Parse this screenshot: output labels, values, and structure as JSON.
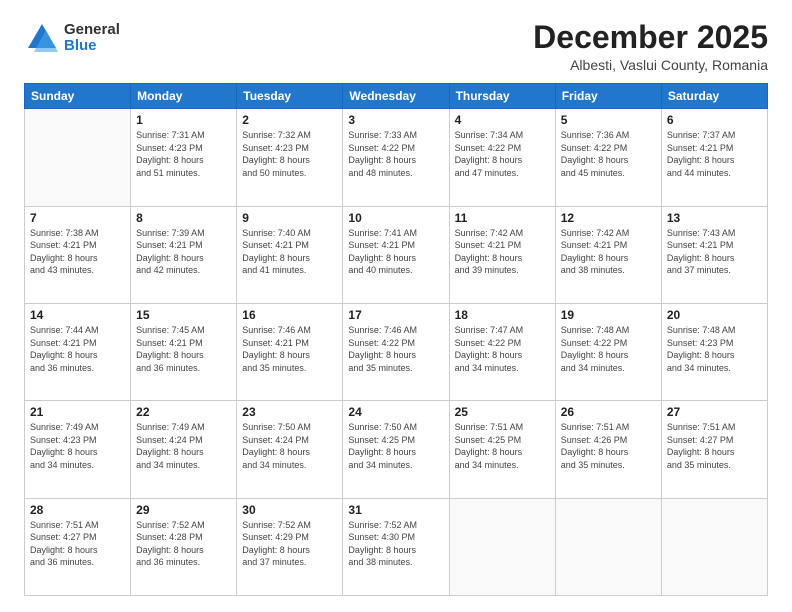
{
  "logo": {
    "general": "General",
    "blue": "Blue"
  },
  "header": {
    "month": "December 2025",
    "location": "Albesti, Vaslui County, Romania"
  },
  "weekdays": [
    "Sunday",
    "Monday",
    "Tuesday",
    "Wednesday",
    "Thursday",
    "Friday",
    "Saturday"
  ],
  "weeks": [
    [
      {
        "day": "",
        "info": ""
      },
      {
        "day": "1",
        "info": "Sunrise: 7:31 AM\nSunset: 4:23 PM\nDaylight: 8 hours\nand 51 minutes."
      },
      {
        "day": "2",
        "info": "Sunrise: 7:32 AM\nSunset: 4:23 PM\nDaylight: 8 hours\nand 50 minutes."
      },
      {
        "day": "3",
        "info": "Sunrise: 7:33 AM\nSunset: 4:22 PM\nDaylight: 8 hours\nand 48 minutes."
      },
      {
        "day": "4",
        "info": "Sunrise: 7:34 AM\nSunset: 4:22 PM\nDaylight: 8 hours\nand 47 minutes."
      },
      {
        "day": "5",
        "info": "Sunrise: 7:36 AM\nSunset: 4:22 PM\nDaylight: 8 hours\nand 45 minutes."
      },
      {
        "day": "6",
        "info": "Sunrise: 7:37 AM\nSunset: 4:21 PM\nDaylight: 8 hours\nand 44 minutes."
      }
    ],
    [
      {
        "day": "7",
        "info": "Sunrise: 7:38 AM\nSunset: 4:21 PM\nDaylight: 8 hours\nand 43 minutes."
      },
      {
        "day": "8",
        "info": "Sunrise: 7:39 AM\nSunset: 4:21 PM\nDaylight: 8 hours\nand 42 minutes."
      },
      {
        "day": "9",
        "info": "Sunrise: 7:40 AM\nSunset: 4:21 PM\nDaylight: 8 hours\nand 41 minutes."
      },
      {
        "day": "10",
        "info": "Sunrise: 7:41 AM\nSunset: 4:21 PM\nDaylight: 8 hours\nand 40 minutes."
      },
      {
        "day": "11",
        "info": "Sunrise: 7:42 AM\nSunset: 4:21 PM\nDaylight: 8 hours\nand 39 minutes."
      },
      {
        "day": "12",
        "info": "Sunrise: 7:42 AM\nSunset: 4:21 PM\nDaylight: 8 hours\nand 38 minutes."
      },
      {
        "day": "13",
        "info": "Sunrise: 7:43 AM\nSunset: 4:21 PM\nDaylight: 8 hours\nand 37 minutes."
      }
    ],
    [
      {
        "day": "14",
        "info": "Sunrise: 7:44 AM\nSunset: 4:21 PM\nDaylight: 8 hours\nand 36 minutes."
      },
      {
        "day": "15",
        "info": "Sunrise: 7:45 AM\nSunset: 4:21 PM\nDaylight: 8 hours\nand 36 minutes."
      },
      {
        "day": "16",
        "info": "Sunrise: 7:46 AM\nSunset: 4:21 PM\nDaylight: 8 hours\nand 35 minutes."
      },
      {
        "day": "17",
        "info": "Sunrise: 7:46 AM\nSunset: 4:22 PM\nDaylight: 8 hours\nand 35 minutes."
      },
      {
        "day": "18",
        "info": "Sunrise: 7:47 AM\nSunset: 4:22 PM\nDaylight: 8 hours\nand 34 minutes."
      },
      {
        "day": "19",
        "info": "Sunrise: 7:48 AM\nSunset: 4:22 PM\nDaylight: 8 hours\nand 34 minutes."
      },
      {
        "day": "20",
        "info": "Sunrise: 7:48 AM\nSunset: 4:23 PM\nDaylight: 8 hours\nand 34 minutes."
      }
    ],
    [
      {
        "day": "21",
        "info": "Sunrise: 7:49 AM\nSunset: 4:23 PM\nDaylight: 8 hours\nand 34 minutes."
      },
      {
        "day": "22",
        "info": "Sunrise: 7:49 AM\nSunset: 4:24 PM\nDaylight: 8 hours\nand 34 minutes."
      },
      {
        "day": "23",
        "info": "Sunrise: 7:50 AM\nSunset: 4:24 PM\nDaylight: 8 hours\nand 34 minutes."
      },
      {
        "day": "24",
        "info": "Sunrise: 7:50 AM\nSunset: 4:25 PM\nDaylight: 8 hours\nand 34 minutes."
      },
      {
        "day": "25",
        "info": "Sunrise: 7:51 AM\nSunset: 4:25 PM\nDaylight: 8 hours\nand 34 minutes."
      },
      {
        "day": "26",
        "info": "Sunrise: 7:51 AM\nSunset: 4:26 PM\nDaylight: 8 hours\nand 35 minutes."
      },
      {
        "day": "27",
        "info": "Sunrise: 7:51 AM\nSunset: 4:27 PM\nDaylight: 8 hours\nand 35 minutes."
      }
    ],
    [
      {
        "day": "28",
        "info": "Sunrise: 7:51 AM\nSunset: 4:27 PM\nDaylight: 8 hours\nand 36 minutes."
      },
      {
        "day": "29",
        "info": "Sunrise: 7:52 AM\nSunset: 4:28 PM\nDaylight: 8 hours\nand 36 minutes."
      },
      {
        "day": "30",
        "info": "Sunrise: 7:52 AM\nSunset: 4:29 PM\nDaylight: 8 hours\nand 37 minutes."
      },
      {
        "day": "31",
        "info": "Sunrise: 7:52 AM\nSunset: 4:30 PM\nDaylight: 8 hours\nand 38 minutes."
      },
      {
        "day": "",
        "info": ""
      },
      {
        "day": "",
        "info": ""
      },
      {
        "day": "",
        "info": ""
      }
    ]
  ]
}
